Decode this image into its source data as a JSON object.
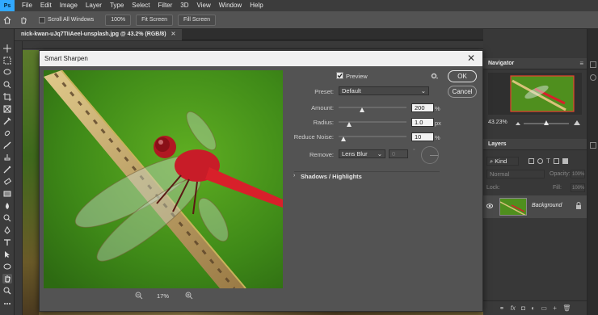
{
  "menu": [
    "File",
    "Edit",
    "Image",
    "Layer",
    "Type",
    "Select",
    "Filter",
    "3D",
    "View",
    "Window",
    "Help"
  ],
  "options": {
    "scroll_all": "Scroll All Windows",
    "zoom100": "100%",
    "fit": "Fit Screen",
    "fill": "Fill Screen"
  },
  "document": {
    "tab_title": "nick-kwan-uJq7TIiAeel-unsplash.jpg @ 43.2% (RGB/8)"
  },
  "dialog": {
    "title": "Smart Sharpen",
    "ok": "OK",
    "cancel": "Cancel",
    "preview_label": "Preview",
    "preset_label": "Preset:",
    "preset_value": "Default",
    "amount_label": "Amount:",
    "amount_value": "200",
    "amount_unit": "%",
    "amount_level": 0.35,
    "radius_label": "Radius:",
    "radius_value": "1.0",
    "radius_unit": "px",
    "radius_level": 0.15,
    "noise_label": "Reduce Noise:",
    "noise_value": "10",
    "noise_unit": "%",
    "noise_level": 0.07,
    "remove_label": "Remove:",
    "remove_value": "Lens Blur",
    "angle_value": "0",
    "shadows_label": "Shadows / Highlights",
    "zoom_value": "17%"
  },
  "navigator": {
    "title": "Navigator",
    "zoom": "43.23%"
  },
  "layers": {
    "title": "Layers",
    "kind": "Kind",
    "blend": "Normal",
    "opacity_label": "Opacity:",
    "opacity_value": "100%",
    "lock_label": "Lock:",
    "fill_label": "Fill:",
    "fill_value": "100%",
    "layer_name": "Background"
  },
  "colors": {
    "accent": "#31a8ff",
    "foliage": "#4f9a1e",
    "dragonfly": "#d8202a"
  }
}
